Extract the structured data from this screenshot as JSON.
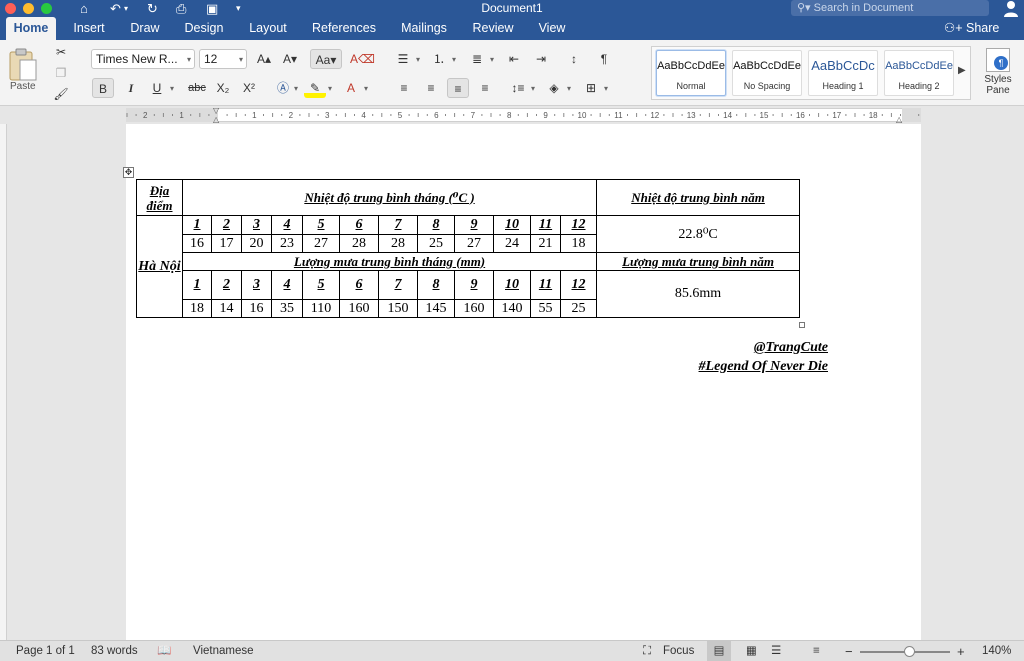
{
  "window": {
    "title": "Document1",
    "search_placeholder": "Search in Document",
    "share_label": "Share"
  },
  "tabs": [
    "Home",
    "Insert",
    "Draw",
    "Design",
    "Layout",
    "References",
    "Mailings",
    "Review",
    "View"
  ],
  "ribbon": {
    "paste_label": "Paste",
    "font_name": "Times New R...",
    "font_size": "12",
    "bold": "B",
    "italic": "I",
    "underline": "U",
    "strike": "abc",
    "styles": [
      {
        "sample": "AaBbCcDdEe",
        "name": "Normal"
      },
      {
        "sample": "AaBbCcDdEe",
        "name": "No Spacing"
      },
      {
        "sample": "AaBbCcDc",
        "name": "Heading 1"
      },
      {
        "sample": "AaBbCcDdEe",
        "name": "Heading 2"
      }
    ],
    "styles_pane_label": "Styles Pane",
    "heading_color": "#2b5797"
  },
  "ruler": {
    "labels": [
      "2",
      "1",
      "1",
      "2",
      "3",
      "4",
      "5",
      "6",
      "7",
      "8",
      "9",
      "10",
      "11",
      "12",
      "13",
      "14",
      "15",
      "16",
      "17",
      "18"
    ]
  },
  "document": {
    "location_header": "Địa điểm",
    "location": "Hà Nội",
    "temp_header": "Nhiệt độ trung bình tháng (⁰C )",
    "temp_year_header": "Nhiệt độ trung bình năm",
    "rain_header": "Lượng mưa trung bình tháng (mm)",
    "rain_year_header": "Lượng mưa trung bình năm",
    "months": [
      "1",
      "2",
      "3",
      "4",
      "5",
      "6",
      "7",
      "8",
      "9",
      "10",
      "11",
      "12"
    ],
    "temps": [
      "16",
      "17",
      "20",
      "23",
      "27",
      "28",
      "28",
      "25",
      "27",
      "24",
      "21",
      "18"
    ],
    "rain": [
      "18",
      "14",
      "16",
      "35",
      "110",
      "160",
      "150",
      "145",
      "160",
      "140",
      "55",
      "25"
    ],
    "temp_year": "22.8⁰C",
    "rain_year": "85.6mm",
    "signature_1": "@TrangCute",
    "signature_2": "#Legend Of Never Die"
  },
  "status": {
    "page": "Page 1 of 1",
    "words": "83 words",
    "language": "Vietnamese",
    "focus": "Focus",
    "zoom": "140%"
  }
}
